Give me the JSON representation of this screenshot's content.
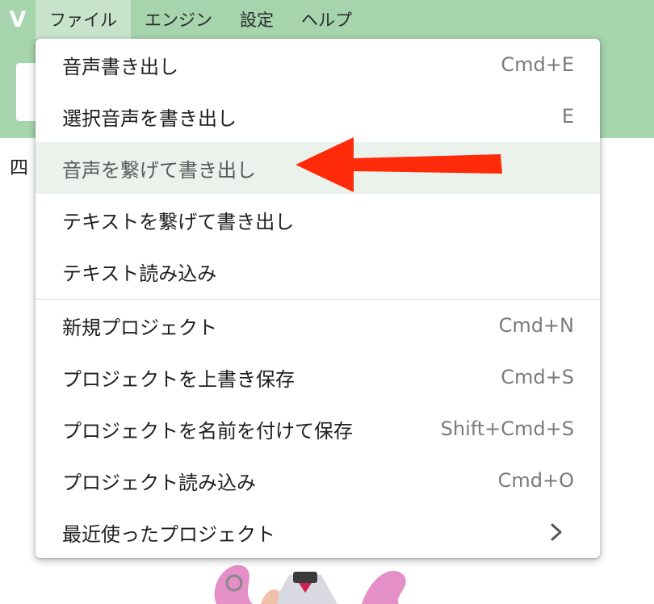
{
  "menubar": {
    "logo": "V",
    "items": [
      {
        "label": "ファイル"
      },
      {
        "label": "エンジン"
      },
      {
        "label": "設定"
      },
      {
        "label": "ヘルプ"
      }
    ]
  },
  "background": {
    "visible_text": "四"
  },
  "file_menu": {
    "items": [
      {
        "label": "音声書き出し",
        "shortcut": "Cmd+E"
      },
      {
        "label": "選択音声を書き出し",
        "shortcut": "E"
      },
      {
        "label": "音声を繋げて書き出し",
        "shortcut": ""
      },
      {
        "label": "テキストを繋げて書き出し",
        "shortcut": ""
      },
      {
        "label": "テキスト読み込み",
        "shortcut": ""
      },
      {
        "label": "新規プロジェクト",
        "shortcut": "Cmd+N"
      },
      {
        "label": "プロジェクトを上書き保存",
        "shortcut": "Cmd+S"
      },
      {
        "label": "プロジェクトを名前を付けて保存",
        "shortcut": "Shift+Cmd+S"
      },
      {
        "label": "プロジェクト読み込み",
        "shortcut": "Cmd+O"
      },
      {
        "label": "最近使ったプロジェクト",
        "shortcut": ""
      }
    ],
    "submenu_icon": "chevron-right-icon"
  },
  "annotation": {
    "arrow_color": "#ff2a0a",
    "points_to": "音声を繋げて書き出し"
  },
  "colors": {
    "menubar": "#a5d4ad",
    "active_menu": "#c8e3cc",
    "highlight_row": "#eaf2eb"
  }
}
